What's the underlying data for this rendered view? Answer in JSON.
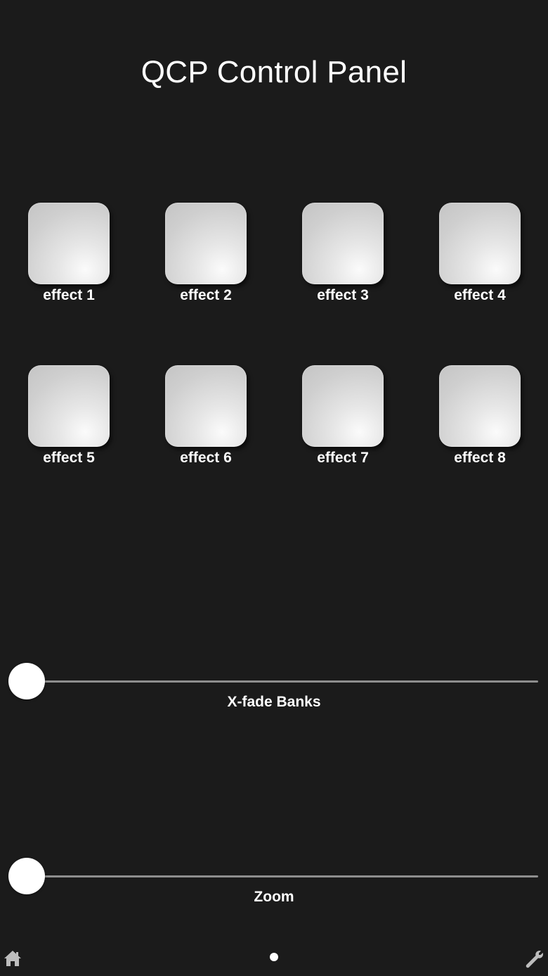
{
  "header": {
    "title": "QCP Control Panel"
  },
  "pads": [
    {
      "label": "effect 1"
    },
    {
      "label": "effect 2"
    },
    {
      "label": "effect 3"
    },
    {
      "label": "effect 4"
    },
    {
      "label": "effect 5"
    },
    {
      "label": "effect 6"
    },
    {
      "label": "effect 7"
    },
    {
      "label": "effect 8"
    }
  ],
  "sliders": {
    "xfade": {
      "label": "X-fade Banks",
      "value": 0
    },
    "zoom": {
      "label": "Zoom",
      "value": 0
    }
  },
  "footer": {
    "home_icon": "home-icon",
    "settings_icon": "wrench-icon",
    "page_indicator": {
      "pages": 1,
      "current": 1
    }
  },
  "colors": {
    "background": "#1b1b1b",
    "text": "#ffffff",
    "track": "#8e8e8e"
  }
}
